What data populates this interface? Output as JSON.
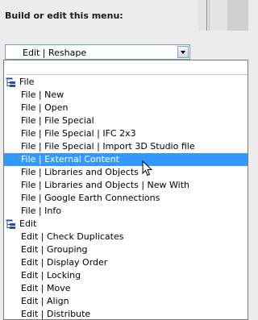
{
  "heading": "Build or edit this menu:",
  "combo": {
    "value": "Edit | Reshape"
  },
  "menu": {
    "rows": [
      {
        "kind": "group",
        "label": "File"
      },
      {
        "kind": "child",
        "label": "File | New"
      },
      {
        "kind": "child",
        "label": "File | Open"
      },
      {
        "kind": "child",
        "label": "File | File Special"
      },
      {
        "kind": "child",
        "label": "File | File Special | IFC 2x3"
      },
      {
        "kind": "child",
        "label": "File | File Special | Import 3D Studio file"
      },
      {
        "kind": "child",
        "label": "File | External Content",
        "selected": true
      },
      {
        "kind": "child",
        "label": "File | Libraries and Objects"
      },
      {
        "kind": "child",
        "label": "File | Libraries and Objects | New With"
      },
      {
        "kind": "child",
        "label": "File | Google Earth Connections"
      },
      {
        "kind": "child",
        "label": "File | Info"
      },
      {
        "kind": "group",
        "label": "Edit"
      },
      {
        "kind": "child",
        "label": "Edit | Check Duplicates"
      },
      {
        "kind": "child",
        "label": "Edit | Grouping"
      },
      {
        "kind": "child",
        "label": "Edit | Display Order"
      },
      {
        "kind": "child",
        "label": "Edit | Locking"
      },
      {
        "kind": "child",
        "label": "Edit | Move"
      },
      {
        "kind": "child",
        "label": "Edit | Align"
      },
      {
        "kind": "child",
        "label": "Edit | Distribute"
      }
    ]
  },
  "colors": {
    "selection": "#3399ff",
    "combo_border": "#7f9db9"
  },
  "icons": {
    "group": "tree-icon",
    "cursor": "mouse-pointer-icon",
    "dropdown": "chevron-down-icon"
  }
}
